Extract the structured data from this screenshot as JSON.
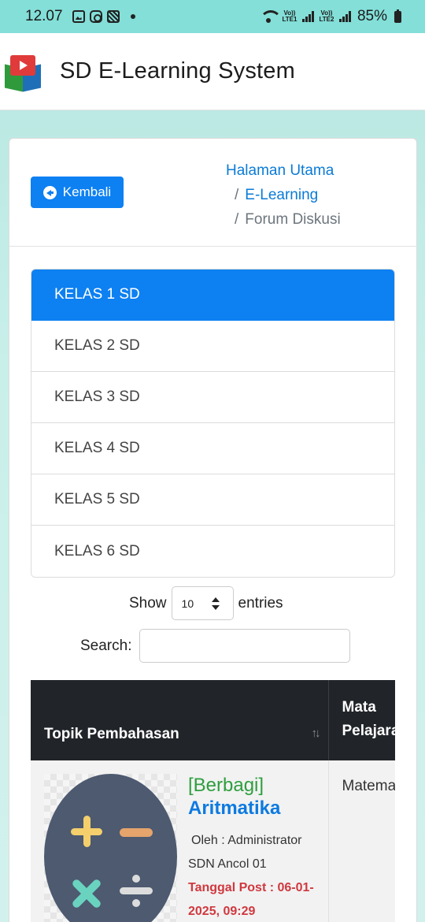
{
  "status_bar": {
    "time": "12.07",
    "battery": "85%",
    "volte_1": "Vo)) LTE1",
    "volte_2": "Vo)) LTE2"
  },
  "app": {
    "title": "SD E-Learning System"
  },
  "toolbar": {
    "back_label": "Kembali"
  },
  "breadcrumb": {
    "items": [
      {
        "label": "Halaman Utama"
      },
      {
        "label": "E-Learning"
      },
      {
        "label": "Forum Diskusi"
      }
    ],
    "separator": "/"
  },
  "classes": [
    {
      "label": "KELAS 1 SD",
      "active": true
    },
    {
      "label": "KELAS 2 SD",
      "active": false
    },
    {
      "label": "KELAS 3 SD",
      "active": false
    },
    {
      "label": "KELAS 4 SD",
      "active": false
    },
    {
      "label": "KELAS 5 SD",
      "active": false
    },
    {
      "label": "KELAS 6 SD",
      "active": false
    }
  ],
  "datatable": {
    "show_label": "Show",
    "entries_value": "10",
    "entries_label": "entries",
    "search_label": "Search:",
    "search_value": ""
  },
  "table": {
    "headers": [
      "Topik Pembahasan",
      "Mata Pelajaran"
    ],
    "header_mapel_visible": [
      "Mata",
      "Pelajara"
    ],
    "rows": [
      {
        "tag": "[Berbagi]",
        "title": "Aritmatika",
        "author": "Oleh : Administrator",
        "school": "SDN Ancol 01",
        "date": "Tanggal Post : 06-01-2025, 09:29",
        "date_line1": "Tanggal Post : 06-01-",
        "date_line2": "2025, 09:29",
        "mapel_visible": "Matema"
      }
    ]
  },
  "colors": {
    "primary": "#0d80f2",
    "header_dark": "#212529",
    "tag_green": "#2e9e3e",
    "date_red": "#d0383f",
    "status_bar": "#83dfd8"
  },
  "icons": {
    "back": "arrow-circle-left-icon",
    "sort": "sort-icon",
    "select": "select-arrows-icon"
  }
}
